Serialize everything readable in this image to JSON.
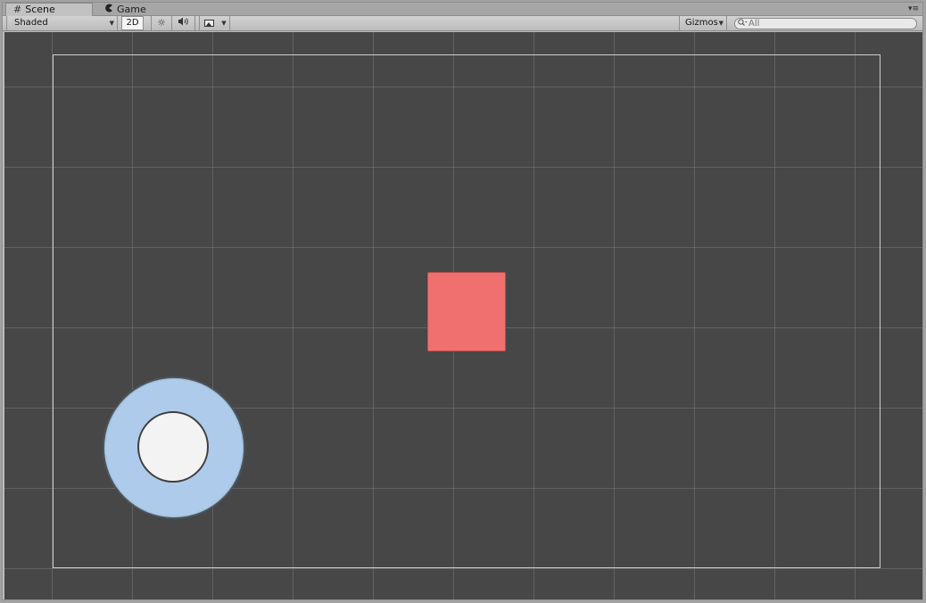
{
  "tabs": {
    "scene": {
      "label": "Scene",
      "icon": "#"
    },
    "game": {
      "label": "Game",
      "icon": "pac-man-icon"
    },
    "menu_icon": "▾≡"
  },
  "toolbar": {
    "shading_mode": "Shaded",
    "mode_2d_label": "2D",
    "mode_2d_active": true,
    "lighting_icon": "☼",
    "audio_icon": "🔊",
    "gizmos_label": "Gizmos",
    "search": {
      "placeholder": "All",
      "value": ""
    }
  },
  "scene": {
    "background": "#474747",
    "grid_color": "#6e6e6e",
    "objects": [
      {
        "name": "red-square",
        "color": "#f07070"
      },
      {
        "name": "joystick",
        "base_color": "#aecbeb",
        "knob_color": "#f3f3f3"
      }
    ]
  }
}
